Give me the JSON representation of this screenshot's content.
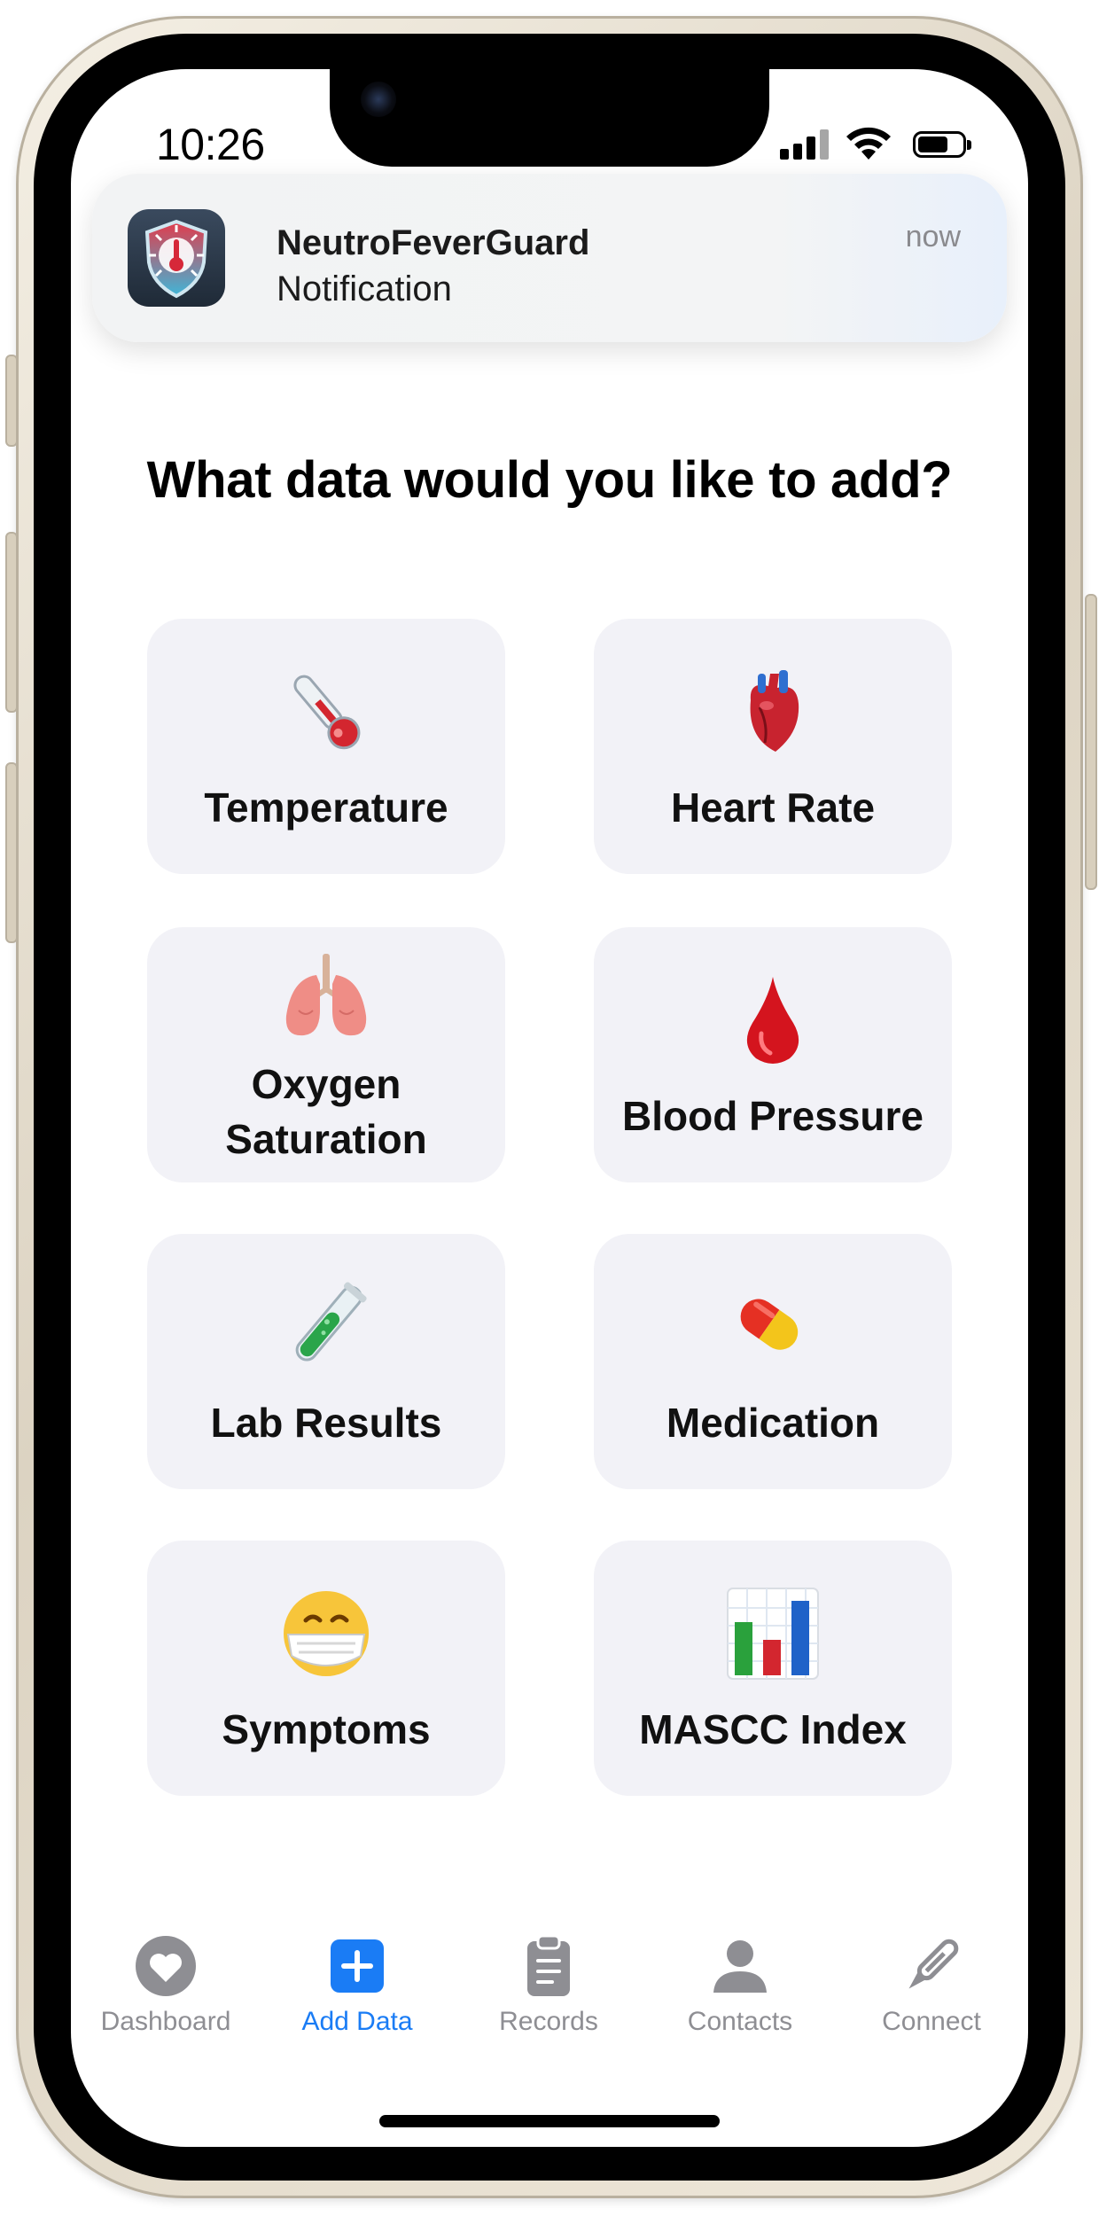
{
  "status_bar": {
    "time": "10:26"
  },
  "notification": {
    "app_name": "NeutroFeverGuard",
    "body": "Notification",
    "timestamp": "now"
  },
  "heading": "What data would you like to add?",
  "tiles": [
    {
      "label": "Temperature",
      "icon": "thermometer-icon"
    },
    {
      "label": "Heart Rate",
      "icon": "anatomical-heart-icon"
    },
    {
      "label": "Oxygen Saturation",
      "icon": "lungs-icon"
    },
    {
      "label": "Blood Pressure",
      "icon": "drop-of-blood-icon"
    },
    {
      "label": "Lab Results",
      "icon": "test-tube-icon"
    },
    {
      "label": "Medication",
      "icon": "pill-icon"
    },
    {
      "label": "Symptoms",
      "icon": "face-with-medical-mask-icon"
    },
    {
      "label": "MASCC Index",
      "icon": "bar-chart-icon"
    }
  ],
  "tab_bar": {
    "items": [
      {
        "label": "Dashboard",
        "icon": "heart-circle-icon",
        "active": false
      },
      {
        "label": "Add Data",
        "icon": "plus-square-icon",
        "active": true
      },
      {
        "label": "Records",
        "icon": "clipboard-icon",
        "active": false
      },
      {
        "label": "Contacts",
        "icon": "person-icon",
        "active": false
      },
      {
        "label": "Connect",
        "icon": "thermometer-pen-icon",
        "active": false
      }
    ]
  },
  "colors": {
    "accent": "#1a7cf5",
    "tile_bg": "#f2f2f7",
    "inactive": "#8e8e93"
  }
}
